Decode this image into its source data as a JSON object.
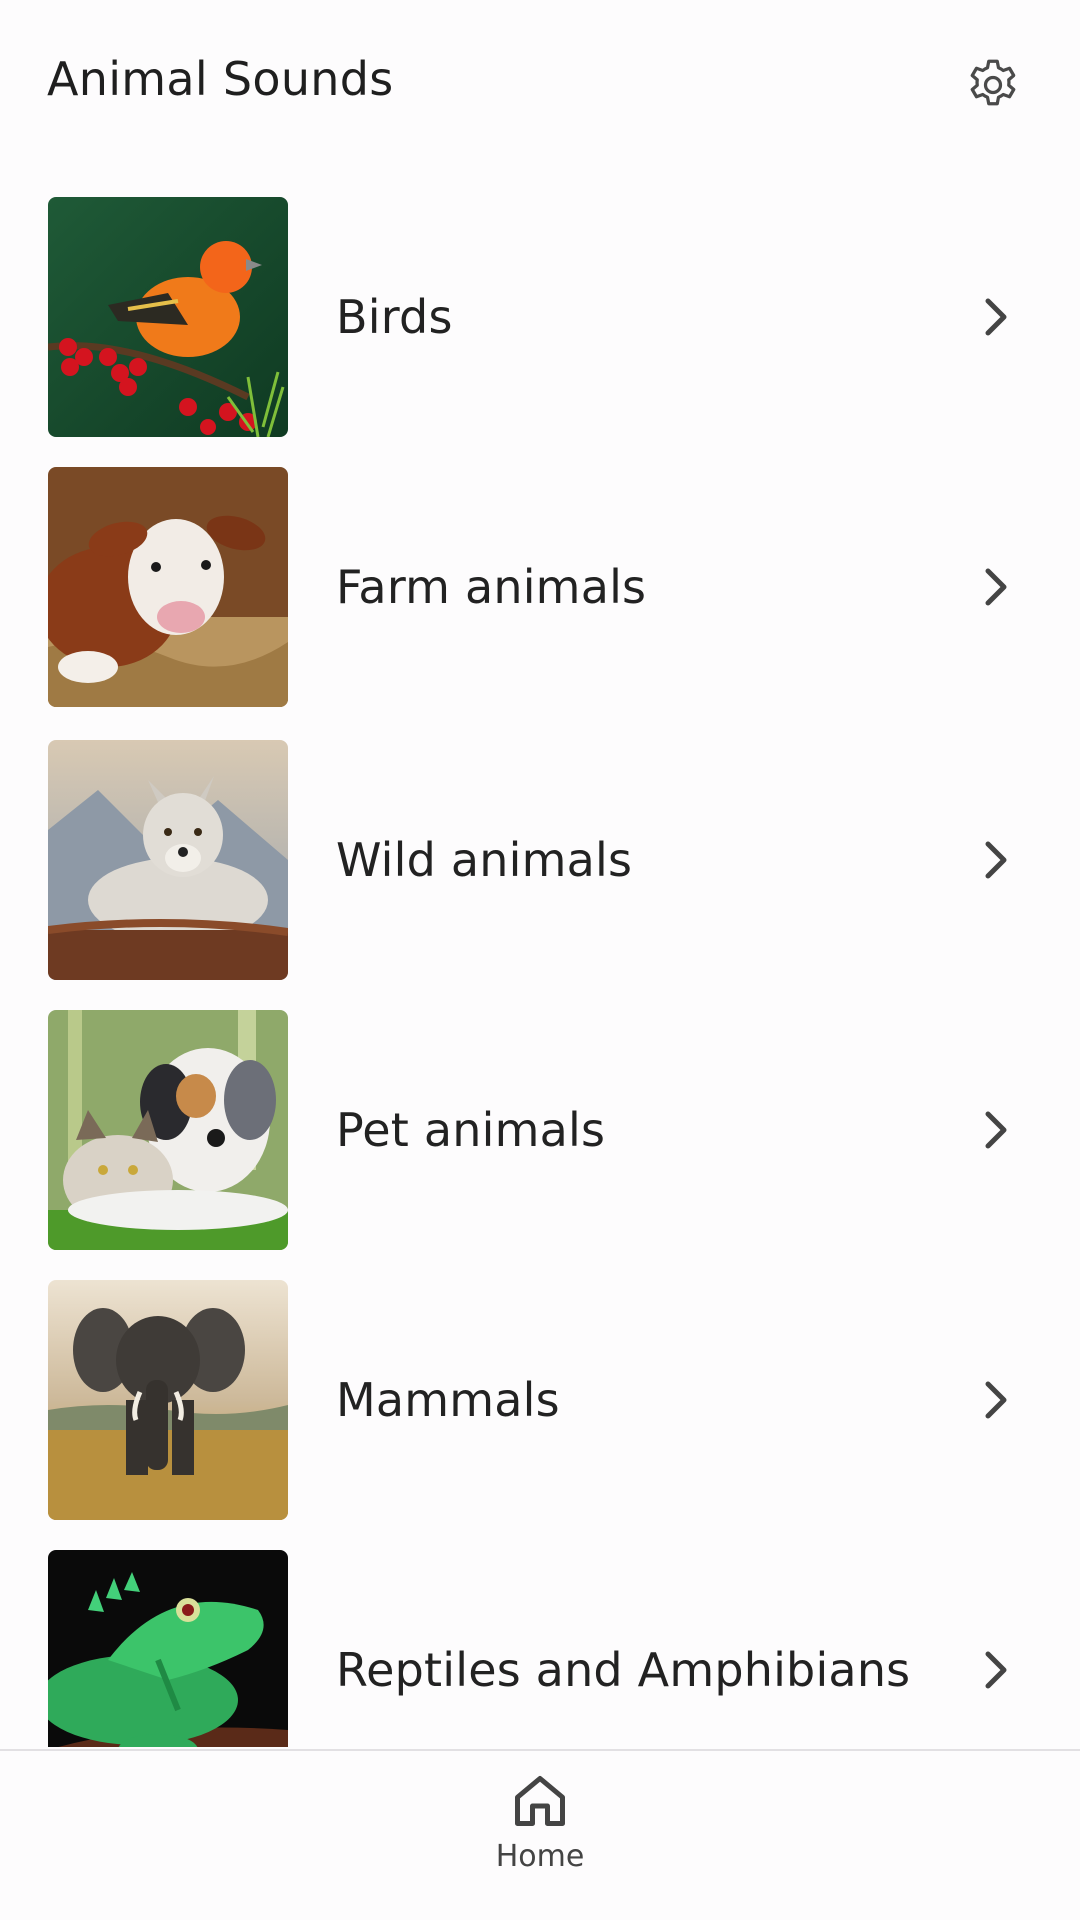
{
  "header": {
    "title": "Animal Sounds",
    "settings_icon": "gear-icon"
  },
  "categories": [
    {
      "label": "Birds",
      "image": "orange-bird-on-berry-branch"
    },
    {
      "label": "Farm animals",
      "image": "calf-lying-in-hay"
    },
    {
      "label": "Wild animals",
      "image": "grey-wolf-on-rock"
    },
    {
      "label": "Pet animals",
      "image": "dog-and-cat-in-grass"
    },
    {
      "label": "Mammals",
      "image": "elephant-walking-in-savanna"
    },
    {
      "label": "Reptiles and Amphibians",
      "image": "green-iguana-on-branch"
    }
  ],
  "bottom_nav": {
    "home_label": "Home",
    "home_icon": "home-icon"
  },
  "colors": {
    "background": "#fdfcfd",
    "text": "#1f1f1f",
    "icon": "#444444",
    "divider": "#e2e0e3"
  }
}
